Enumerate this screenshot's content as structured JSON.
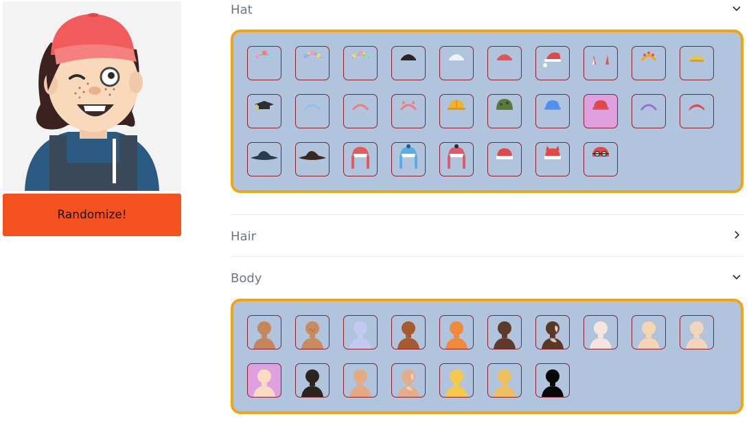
{
  "preview": {
    "randomize_label": "Randomize!"
  },
  "sections": [
    {
      "id": "hat",
      "title": "Hat",
      "expanded": true,
      "chevron": "chevron-down-icon"
    },
    {
      "id": "hair",
      "title": "Hair",
      "expanded": false,
      "chevron": "chevron-right-icon"
    },
    {
      "id": "body",
      "title": "Body",
      "expanded": true,
      "chevron": "chevron-down-icon"
    }
  ],
  "hat_options": [
    {
      "name": "flower-crown-pink",
      "selected": false
    },
    {
      "name": "flower-crown-blue",
      "selected": false
    },
    {
      "name": "flower-crown-yellow",
      "selected": false
    },
    {
      "name": "beanie-black",
      "selected": false
    },
    {
      "name": "beanie-white",
      "selected": false
    },
    {
      "name": "beanie-red",
      "selected": false
    },
    {
      "name": "santa-hat",
      "selected": false
    },
    {
      "name": "devil-horns",
      "selected": false
    },
    {
      "name": "crown-orange",
      "selected": false
    },
    {
      "name": "crown-gold",
      "selected": false
    },
    {
      "name": "graduation-cap",
      "selected": false
    },
    {
      "name": "headband-blue",
      "selected": false
    },
    {
      "name": "headband-pink",
      "selected": false
    },
    {
      "name": "cat-ears-headband",
      "selected": false
    },
    {
      "name": "hard-hat",
      "selected": false
    },
    {
      "name": "army-helmet",
      "selected": false
    },
    {
      "name": "cap-blue",
      "selected": false
    },
    {
      "name": "cap-red",
      "selected": true
    },
    {
      "name": "headband-purple",
      "selected": false
    },
    {
      "name": "headband-red",
      "selected": false
    },
    {
      "name": "witch-hat-black",
      "selected": false
    },
    {
      "name": "witch-hat-brown",
      "selected": false
    },
    {
      "name": "winter-hat-red",
      "selected": false
    },
    {
      "name": "winter-hat-blue",
      "selected": false
    },
    {
      "name": "winter-hat-pink",
      "selected": false
    },
    {
      "name": "santa-beanie",
      "selected": false
    },
    {
      "name": "santa-cat-ears",
      "selected": false
    },
    {
      "name": "swim-cap",
      "selected": false
    }
  ],
  "body_options": [
    {
      "name": "skin-tan",
      "color": "#c4865a",
      "selected": false
    },
    {
      "name": "skin-tan-freckles",
      "color": "#c98a5c",
      "selected": false
    },
    {
      "name": "skin-lavender",
      "color": "#c3c9f2",
      "selected": false
    },
    {
      "name": "skin-brown",
      "color": "#a55b2b",
      "selected": false
    },
    {
      "name": "skin-orange",
      "color": "#f2883a",
      "selected": false
    },
    {
      "name": "skin-dark-brown",
      "color": "#5e3a2a",
      "selected": false
    },
    {
      "name": "skin-dark-vitiligo",
      "color": "#5a3826",
      "selected": false
    },
    {
      "name": "skin-pale",
      "color": "#f4e6df",
      "selected": false
    },
    {
      "name": "skin-peach",
      "color": "#f6d5b3",
      "selected": false
    },
    {
      "name": "skin-peach-vitiligo",
      "color": "#f3d5b9",
      "selected": false
    },
    {
      "name": "skin-light",
      "color": "#f8dcc2",
      "selected": true
    },
    {
      "name": "skin-very-dark",
      "color": "#2e241e",
      "selected": false
    },
    {
      "name": "skin-sand",
      "color": "#e5aa80",
      "selected": false
    },
    {
      "name": "skin-sand-vitiligo",
      "color": "#e2ae89",
      "selected": false
    },
    {
      "name": "skin-yellow",
      "color": "#f5c94a",
      "selected": false
    },
    {
      "name": "skin-mustard",
      "color": "#eebf5c",
      "selected": false
    },
    {
      "name": "skin-black",
      "color": "#080808",
      "selected": false
    }
  ],
  "colors": {
    "accent_border": "#f5a50c",
    "panel_bg": "#b0c4de",
    "tile_border": "#8b1e2b",
    "selected_bg": "#dfa0df",
    "button_bg": "#f4511e"
  }
}
